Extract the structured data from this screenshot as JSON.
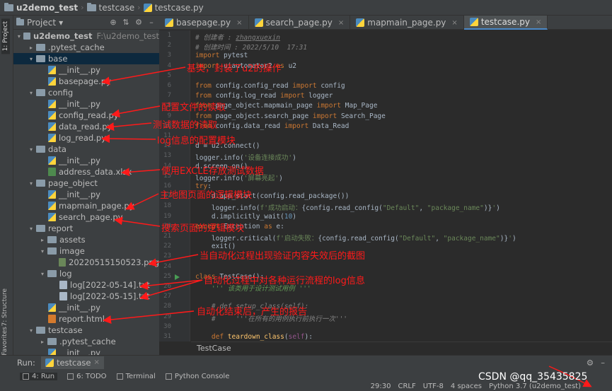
{
  "breadcrumb": {
    "project": "u2demo_test",
    "folder": "testcase",
    "file": "testcase.py"
  },
  "left_stripe": {
    "project": "1: Project",
    "structure": "7: Structure",
    "favorites": "2: Favorites"
  },
  "project_panel": {
    "title": "Project",
    "dropdown": "▾"
  },
  "tree": [
    {
      "depth": 0,
      "arrow": "▾",
      "icon": "folder",
      "label": "u2demo_test",
      "extra": "F:\\u2demo_test",
      "bold": true
    },
    {
      "depth": 1,
      "arrow": "▸",
      "icon": "folder",
      "label": ".pytest_cache"
    },
    {
      "depth": 1,
      "arrow": "▾",
      "icon": "folder",
      "label": "base",
      "selected": true
    },
    {
      "depth": 2,
      "arrow": "",
      "icon": "py",
      "label": "__init__.py"
    },
    {
      "depth": 2,
      "arrow": "",
      "icon": "py",
      "label": "basepage.py"
    },
    {
      "depth": 1,
      "arrow": "▾",
      "icon": "folder",
      "label": "config"
    },
    {
      "depth": 2,
      "arrow": "",
      "icon": "py",
      "label": "__init__.py"
    },
    {
      "depth": 2,
      "arrow": "",
      "icon": "py",
      "label": "config_read.py"
    },
    {
      "depth": 2,
      "arrow": "",
      "icon": "py",
      "label": "data_read.py"
    },
    {
      "depth": 2,
      "arrow": "",
      "icon": "py",
      "label": "log_read.py"
    },
    {
      "depth": 1,
      "arrow": "▾",
      "icon": "folder",
      "label": "data"
    },
    {
      "depth": 2,
      "arrow": "",
      "icon": "py",
      "label": "__init__.py"
    },
    {
      "depth": 2,
      "arrow": "",
      "icon": "xlsx",
      "label": "address_data.xlsx"
    },
    {
      "depth": 1,
      "arrow": "▾",
      "icon": "folder",
      "label": "page_object"
    },
    {
      "depth": 2,
      "arrow": "",
      "icon": "py",
      "label": "__init__.py"
    },
    {
      "depth": 2,
      "arrow": "",
      "icon": "py",
      "label": "mapmain_page.py"
    },
    {
      "depth": 2,
      "arrow": "",
      "icon": "py",
      "label": "search_page.py"
    },
    {
      "depth": 1,
      "arrow": "▾",
      "icon": "folder",
      "label": "report"
    },
    {
      "depth": 2,
      "arrow": "▸",
      "icon": "folder",
      "label": "assets"
    },
    {
      "depth": 2,
      "arrow": "▾",
      "icon": "folder",
      "label": "image"
    },
    {
      "depth": 3,
      "arrow": "",
      "icon": "png",
      "label": "20220515150523.png"
    },
    {
      "depth": 2,
      "arrow": "▾",
      "icon": "folder",
      "label": "log"
    },
    {
      "depth": 3,
      "arrow": "",
      "icon": "txt",
      "label": "log[2022-05-14].txt"
    },
    {
      "depth": 3,
      "arrow": "",
      "icon": "txt",
      "label": "log[2022-05-15].txt"
    },
    {
      "depth": 2,
      "arrow": "",
      "icon": "py",
      "label": "__init__.py"
    },
    {
      "depth": 2,
      "arrow": "",
      "icon": "html",
      "label": "report.html"
    },
    {
      "depth": 1,
      "arrow": "▾",
      "icon": "folder",
      "label": "testcase"
    },
    {
      "depth": 2,
      "arrow": "▸",
      "icon": "folder",
      "label": ".pytest_cache"
    },
    {
      "depth": 2,
      "arrow": "",
      "icon": "py",
      "label": "__init__.py"
    }
  ],
  "tabs": [
    {
      "label": "basepage.py",
      "active": false
    },
    {
      "label": "search_page.py",
      "active": false
    },
    {
      "label": "mapmain_page.py",
      "active": false
    },
    {
      "label": "testcase.py",
      "active": true
    }
  ],
  "code_lines": [
    {
      "n": "1",
      "html": "<span class='cm'># 创建者 : <span class='ul'>zhangxuexin</span></span>"
    },
    {
      "n": "2",
      "html": "<span class='cm'># 创建时间 : 2022/5/10  17:31</span>"
    },
    {
      "n": "3",
      "html": "<span class='kw'>import</span> pytest"
    },
    {
      "n": "4",
      "html": "<span class='kw'>import</span> uiautomator2 <span class='kw'>as</span> u2"
    },
    {
      "n": "5",
      "html": ""
    },
    {
      "n": "6",
      "html": "<span class='kw'>from</span> config.config_read <span class='kw'>import</span> config"
    },
    {
      "n": "7",
      "html": "<span class='kw'>from</span> config.log_read <span class='kw'>import</span> logger"
    },
    {
      "n": "8",
      "html": "<span class='kw'>from</span> page_object.mapmain_page <span class='kw'>import</span> Map_Page"
    },
    {
      "n": "9",
      "html": "<span class='kw'>from</span> page_object.search_page <span class='kw'>import</span> Search_Page"
    },
    {
      "n": "10",
      "html": "<span class='kw'>from</span> config.data_read <span class='kw'>import</span> Data_Read"
    },
    {
      "n": "11",
      "html": ""
    },
    {
      "n": "12",
      "html": "d = u2.connect()"
    },
    {
      "n": "13",
      "html": "logger.info(<span class='st'>'设备连接成功'</span>)"
    },
    {
      "n": "14",
      "html": "d.screen_on()"
    },
    {
      "n": "15",
      "html": "logger.info(<span class='st'>'屏幕亮起'</span>)"
    },
    {
      "n": "16",
      "html": "<span class='kw'>try</span>:"
    },
    {
      "n": "17",
      "html": "    d.app_start(config.read_package())"
    },
    {
      "n": "18",
      "html": "    logger.info(<span class='st'>f'成功启动：</span>{config.read_config(<span class='st'>\"Default\"</span>, <span class='st'>\"package_name\"</span>)}<span class='st'>'</span>)"
    },
    {
      "n": "19",
      "html": "    d.implicitly_wait(<span style='color:#6897bb'>10</span>)"
    },
    {
      "n": "20",
      "html": "<span class='kw'>except</span> Exception <span class='kw'>as</span> e:"
    },
    {
      "n": "21",
      "html": "    logger.critical(<span class='st'>f'启动失败：</span>{config.read_config(<span class='st'>\"Default\"</span>, <span class='st'>\"package_name\"</span>)}<span class='st'>'</span>)"
    },
    {
      "n": "22",
      "html": "    exit()"
    },
    {
      "n": "23",
      "html": ""
    },
    {
      "n": "24",
      "html": ""
    },
    {
      "n": "25",
      "html": "<span class='kw'>class</span> TestCase():"
    },
    {
      "n": "26",
      "html": "    <span class='doc'>''' 该类用于设计测试用例 '''</span>"
    },
    {
      "n": "27",
      "html": ""
    },
    {
      "n": "28",
      "html": "    <span class='cm'># def setup_class(self):</span>"
    },
    {
      "n": "29",
      "html": "    <span class='cm'>#     '''在所有的用例执行前执行一次'''</span>"
    },
    {
      "n": "30",
      "html": ""
    },
    {
      "n": "31",
      "html": "    <span class='kw'>def</span> <span class='fn'>teardown_class</span>(<span class='sf'>self</span>):"
    }
  ],
  "editor_breadcrumb": "TestCase",
  "run_bar": {
    "label": "Run:",
    "tab": "testcase"
  },
  "tool_stripe": [
    {
      "label": "4: Run",
      "active": true
    },
    {
      "label": "6: TODO",
      "active": false
    },
    {
      "label": "Terminal",
      "active": false
    },
    {
      "label": "Python Console",
      "active": false
    }
  ],
  "status": {
    "position": "29:30",
    "line_sep": "CRLF",
    "encoding": "UTF-8",
    "indent": "4 spaces",
    "interpreter": "Python 3.7 (u2demo_test)"
  },
  "annotations": [
    "基类，封装了u2的操作",
    "配置文件的读取",
    "测试数据的读取",
    "log信息的配置模块",
    "使用EXCLE存放测试数据",
    "主地图页面的逻辑模块",
    "搜索页面的逻辑模块",
    "当自动化过程出现验证内容失效后的截图",
    "自动化过程中对各种运行流程的log信息",
    "自动化结束后，产生的报告"
  ],
  "watermark": "CSDN @qq_35435825"
}
